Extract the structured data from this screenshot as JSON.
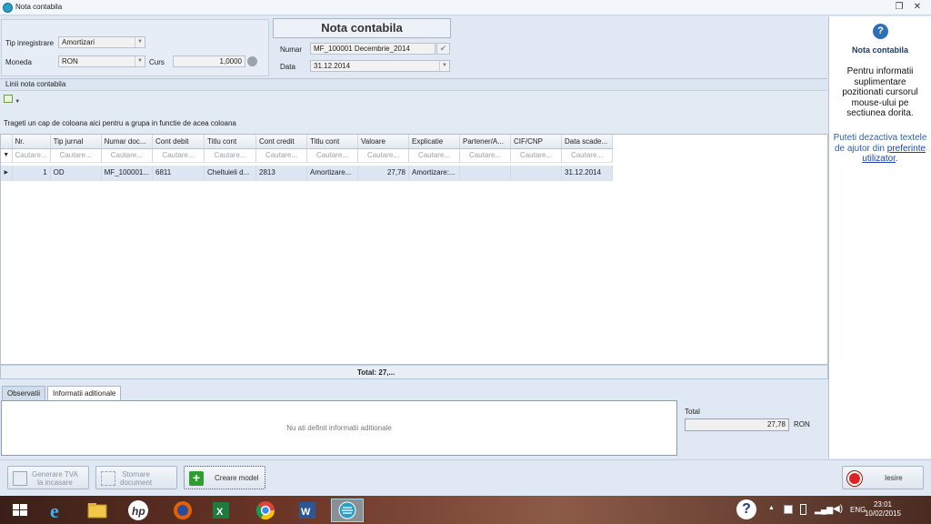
{
  "window": {
    "title": "Nota contabila"
  },
  "header": {
    "doc_title": "Nota contabila",
    "tip_inregistrare_label": "Tip inregistrare",
    "tip_inregistrare_value": "Amortizari",
    "moneda_label": "Moneda",
    "moneda_value": "RON",
    "curs_label": "Curs",
    "curs_value": "1,0000",
    "numar_label": "Numar",
    "numar_value": "MF_100001 Decembrie_2014",
    "data_label": "Data",
    "data_value": "31.12.2014"
  },
  "grid": {
    "section_title": "Linii nota contabila",
    "group_hint": "Trageti un cap de coloana aici pentru a grupa in functie de acea coloana",
    "filter_placeholder": "Cautare...",
    "filter_placeholder_short": "Cautare...",
    "filter_first": "Cautare...",
    "columns": [
      "Nr.",
      "Tip jurnal",
      "Numar doc...",
      "Cont debit",
      "Titlu cont",
      "Cont credit",
      "Titlu cont",
      "Valoare",
      "Explicatie",
      "Partener/A...",
      "CIF/CNP",
      "Data scade..."
    ],
    "rows": [
      [
        "1",
        "OD",
        "MF_100001...",
        "6811",
        "Cheltuieli d...",
        "2813",
        "Amortizare...",
        "27,78",
        "Amortizare:...",
        "",
        "",
        "31.12.2014"
      ]
    ],
    "footer_total": "Total: 27,..."
  },
  "tabs": [
    "Observatii",
    "Informatii aditionale"
  ],
  "notes": {
    "empty_text": "Nu ati definit informatii aditionale"
  },
  "totals": {
    "label": "Total",
    "value": "27,78",
    "currency": "RON"
  },
  "buttons": {
    "generare_tva_1": "Generare TVA",
    "generare_tva_2": "la incasare",
    "stornare_1": "Stornare",
    "stornare_2": "document",
    "creare_model": "Creare model",
    "iesire": "Iesire"
  },
  "help": {
    "title": "Nota contabila",
    "body": "Pentru informatii suplimentare pozitionati cursorul mouse-ului pe sectiunea dorita.",
    "note": "Puteti dezactiva textele de ajutor din",
    "link": "preferinte utilizator",
    "note_end": "."
  },
  "taskbar": {
    "lang": "ENG",
    "time": "23:01",
    "date": "10/02/2015"
  }
}
